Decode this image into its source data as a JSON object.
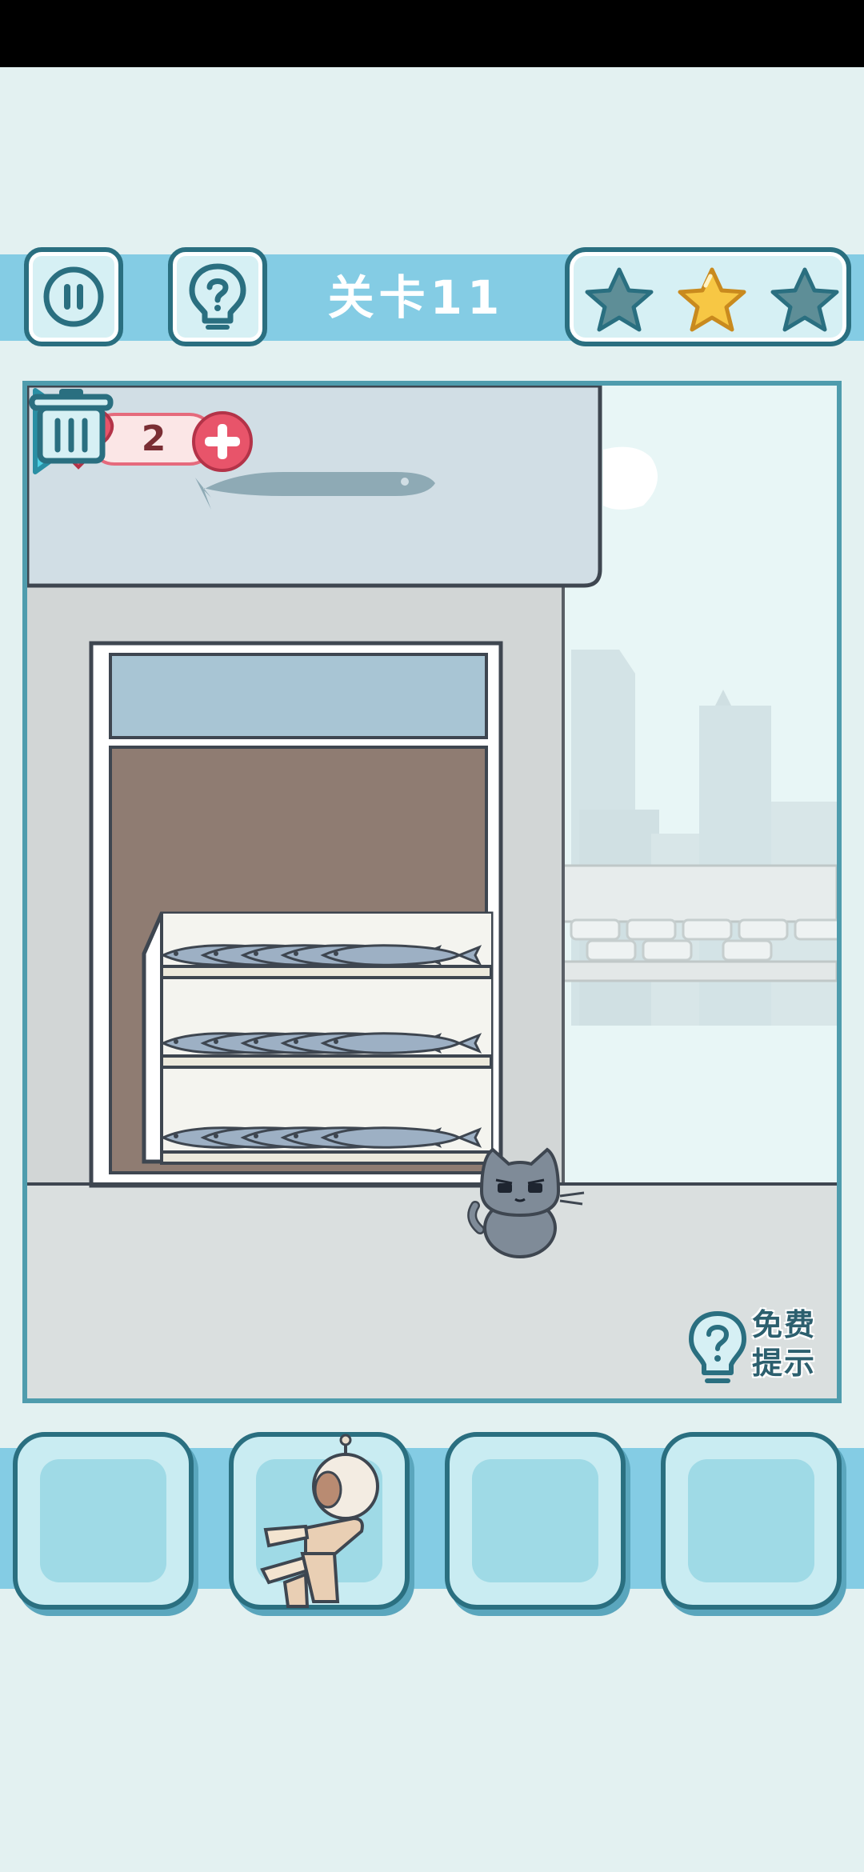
{
  "hud": {
    "level_title": "关卡11",
    "pause_icon": "pause-icon",
    "help_icon": "lightbulb-question-icon",
    "stars": [
      {
        "state": "empty",
        "color": "#5e8e97"
      },
      {
        "state": "filled",
        "color": "#f7c744"
      },
      {
        "state": "empty",
        "color": "#5e8e97"
      }
    ]
  },
  "scene": {
    "lives": "2",
    "hint_label": "免费提示",
    "trash_icon": "trash-icon",
    "next_icon": "play-arrow-icon",
    "fish_shelves": 3,
    "fish_per_shelf": 5
  },
  "inventory": {
    "slots": [
      {
        "item": ""
      },
      {
        "item": "robot-toy"
      },
      {
        "item": ""
      },
      {
        "item": ""
      }
    ]
  },
  "colors": {
    "accent": "#84cce4",
    "border": "#2a6f80",
    "heart": "#e8546a",
    "star_active": "#f7c744"
  }
}
